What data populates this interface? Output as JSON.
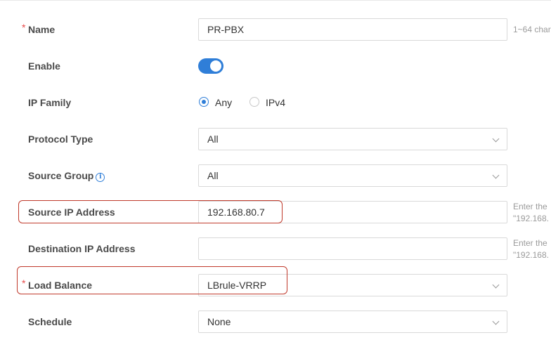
{
  "form": {
    "name": {
      "label": "Name",
      "required_mark": "*",
      "value": "PR-PBX",
      "hint": "1~64 char"
    },
    "enable": {
      "label": "Enable",
      "state": "on"
    },
    "ip_family": {
      "label": "IP Family",
      "options": [
        "Any",
        "IPv4"
      ],
      "selected": "Any"
    },
    "protocol_type": {
      "label": "Protocol Type",
      "value": "All"
    },
    "source_group": {
      "label": "Source Group",
      "info_icon": "i",
      "value": "All"
    },
    "source_ip": {
      "label": "Source IP Address",
      "value": "192.168.80.7",
      "hint_line1": "Enter the",
      "hint_line2": "\"192.168."
    },
    "destination_ip": {
      "label": "Destination IP Address",
      "value": "",
      "hint_line1": "Enter the",
      "hint_line2": "\"192.168."
    },
    "load_balance": {
      "label": "Load Balance",
      "required_mark": "*",
      "value": "LBrule-VRRP"
    },
    "schedule": {
      "label": "Schedule",
      "value": "None"
    }
  },
  "colors": {
    "accent": "#2f7ed8",
    "required": "#e84b4b",
    "highlight_box": "#c0392b"
  }
}
